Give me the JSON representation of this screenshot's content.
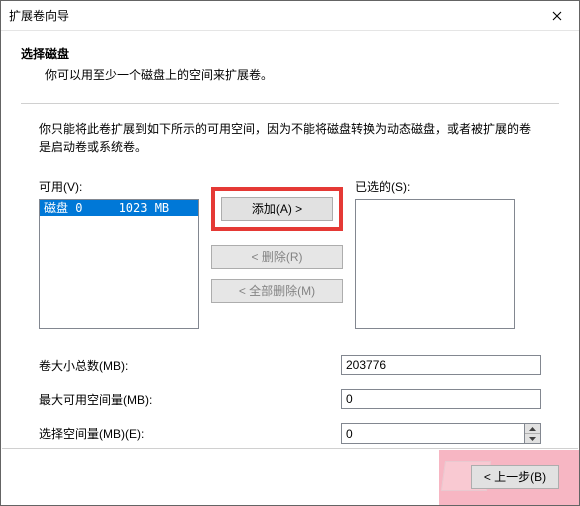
{
  "window": {
    "title": "扩展卷向导"
  },
  "header": {
    "heading": "选择磁盘",
    "subheading": "你可以用至少一个磁盘上的空间来扩展卷。"
  },
  "description": "你只能将此卷扩展到如下所示的可用空间，因为不能将磁盘转换为动态磁盘，或者被扩展的卷是启动卷或系统卷。",
  "lists": {
    "available_label": "可用(V):",
    "selected_label": "已选的(S):",
    "available_items": [
      {
        "text": "磁盘 0     1023 MB",
        "selected": true
      }
    ],
    "selected_items": []
  },
  "buttons": {
    "add": "添加(A) >",
    "remove": "< 删除(R)",
    "remove_all": "< 全部删除(M)"
  },
  "fields": {
    "total_label": "卷大小总数(MB):",
    "total_value": "203776",
    "max_label": "最大可用空间量(MB):",
    "max_value": "0",
    "select_label": "选择空间量(MB)(E):",
    "select_value": "0"
  },
  "footer": {
    "back": "< 上一步(B)"
  }
}
